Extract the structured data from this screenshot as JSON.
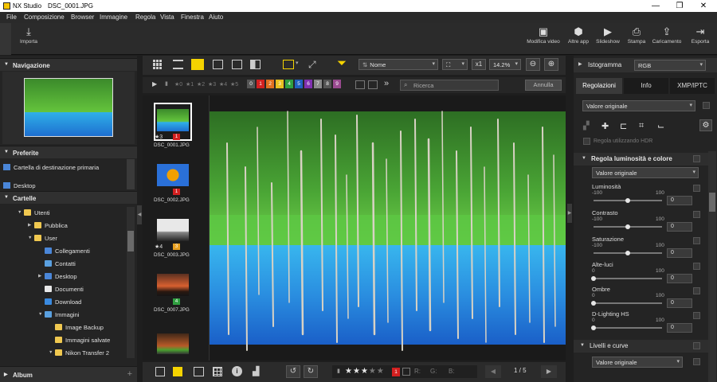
{
  "window": {
    "app_name": "NX Studio",
    "file_name": "DSC_0001.JPG",
    "minimize": "—",
    "maximize": "❐",
    "close": "✕"
  },
  "menu": [
    "File",
    "Composizione",
    "Browser",
    "Immagine",
    "Regola",
    "Vista",
    "Finestra",
    "Aiuto"
  ],
  "toolbar": {
    "import": "Importa",
    "edit_video": "Modifica video",
    "other_apps": "Altre app",
    "slideshow": "Slideshow",
    "print": "Stampa",
    "upload": "Caricamento",
    "export": "Esporta"
  },
  "left": {
    "navigation": "Navigazione",
    "favorites": "Preferite",
    "fav_items": [
      "Cartella di destinazione primaria",
      "Desktop"
    ],
    "folders": "Cartelle",
    "tree": [
      {
        "label": "Utenti",
        "indent": 0,
        "expanded": true,
        "icon": "folder"
      },
      {
        "label": "Pubblica",
        "indent": 1,
        "expanded": false,
        "icon": "folder"
      },
      {
        "label": "User",
        "indent": 1,
        "expanded": true,
        "icon": "folder"
      },
      {
        "label": "Collegamenti",
        "indent": 2,
        "expanded": null,
        "icon": "link"
      },
      {
        "label": "Contatti",
        "indent": 2,
        "expanded": null,
        "icon": "contacts"
      },
      {
        "label": "Desktop",
        "indent": 2,
        "expanded": false,
        "icon": "desktop"
      },
      {
        "label": "Documenti",
        "indent": 2,
        "expanded": null,
        "icon": "docs"
      },
      {
        "label": "Download",
        "indent": 2,
        "expanded": null,
        "icon": "download"
      },
      {
        "label": "Immagini",
        "indent": 2,
        "expanded": true,
        "icon": "images"
      },
      {
        "label": "Image Backup",
        "indent": 3,
        "expanded": null,
        "icon": "folder"
      },
      {
        "label": "Immagini salvate",
        "indent": 3,
        "expanded": null,
        "icon": "folder"
      },
      {
        "label": "Nikon Transfer 2",
        "indent": 3,
        "expanded": true,
        "icon": "folder"
      }
    ],
    "album": "Album",
    "album_add": "+"
  },
  "center": {
    "sort_label": "Nome",
    "zoom_fit": "x1",
    "zoom_value": "14.2%",
    "ratings": [
      "★0",
      "★1",
      "★2",
      "★3",
      "★4",
      "★5"
    ],
    "labels": [
      {
        "n": "0",
        "color": "#555555"
      },
      {
        "n": "1",
        "color": "#d32020"
      },
      {
        "n": "2",
        "color": "#e07020"
      },
      {
        "n": "3",
        "color": "#e8c020"
      },
      {
        "n": "4",
        "color": "#30a040"
      },
      {
        "n": "5",
        "color": "#2060c0"
      },
      {
        "n": "6",
        "color": "#8030b0"
      },
      {
        "n": "7",
        "color": "#8a8a8a"
      },
      {
        "n": "8",
        "color": "#555555"
      },
      {
        "n": "9",
        "color": "#9a4a90"
      }
    ],
    "search_placeholder": "Ricerca",
    "cancel": "Annulla",
    "more": "»",
    "thumbs": [
      {
        "name": "DSC_0001.JPG",
        "badge": "1",
        "badge_color": "#d32020",
        "stars": "★3"
      },
      {
        "name": "DSC_0002.JPG",
        "badge": "1",
        "badge_color": "#d32020",
        "stars": ""
      },
      {
        "name": "DSC_0003.JPG",
        "badge": "3",
        "badge_color": "#e8a020",
        "stars": "★4"
      },
      {
        "name": "DSC_0007.JPG",
        "badge": "4",
        "badge_color": "#30a040",
        "stars": ""
      },
      {
        "name": "",
        "badge": "",
        "badge_color": "",
        "stars": ""
      }
    ],
    "bottom": {
      "r": "R:",
      "g": "G:",
      "b": "B:",
      "page": "1 / 5",
      "rating_label": "1",
      "rating_color": "#d32020",
      "stars_filled": 3
    }
  },
  "right": {
    "histogram": "Istogramma",
    "hist_mode": "RGB",
    "tabs": [
      "Regolazioni",
      "Info",
      "XMP/IPTC"
    ],
    "preset": "Valore originale",
    "hdr": "Regola utilizzando HDR",
    "section1": "Regola luminosità e colore",
    "section1_preset": "Valore originale",
    "sliders": [
      {
        "label": "Luminosità",
        "min": "-100",
        "max": "100",
        "value": "0",
        "pos": 0.5
      },
      {
        "label": "Contrasto",
        "min": "-100",
        "max": "100",
        "value": "0",
        "pos": 0.5
      },
      {
        "label": "Saturazione",
        "min": "-100",
        "max": "100",
        "value": "0",
        "pos": 0.5
      },
      {
        "label": "Alte-luci",
        "min": "0",
        "max": "100",
        "value": "0",
        "pos": 0.0
      },
      {
        "label": "Ombre",
        "min": "0",
        "max": "100",
        "value": "0",
        "pos": 0.0
      },
      {
        "label": "D-Lighting HS",
        "min": "0",
        "max": "100",
        "value": "0",
        "pos": 0.0
      }
    ],
    "section2": "Livelli e curve",
    "section2_preset": "Valore originale"
  }
}
